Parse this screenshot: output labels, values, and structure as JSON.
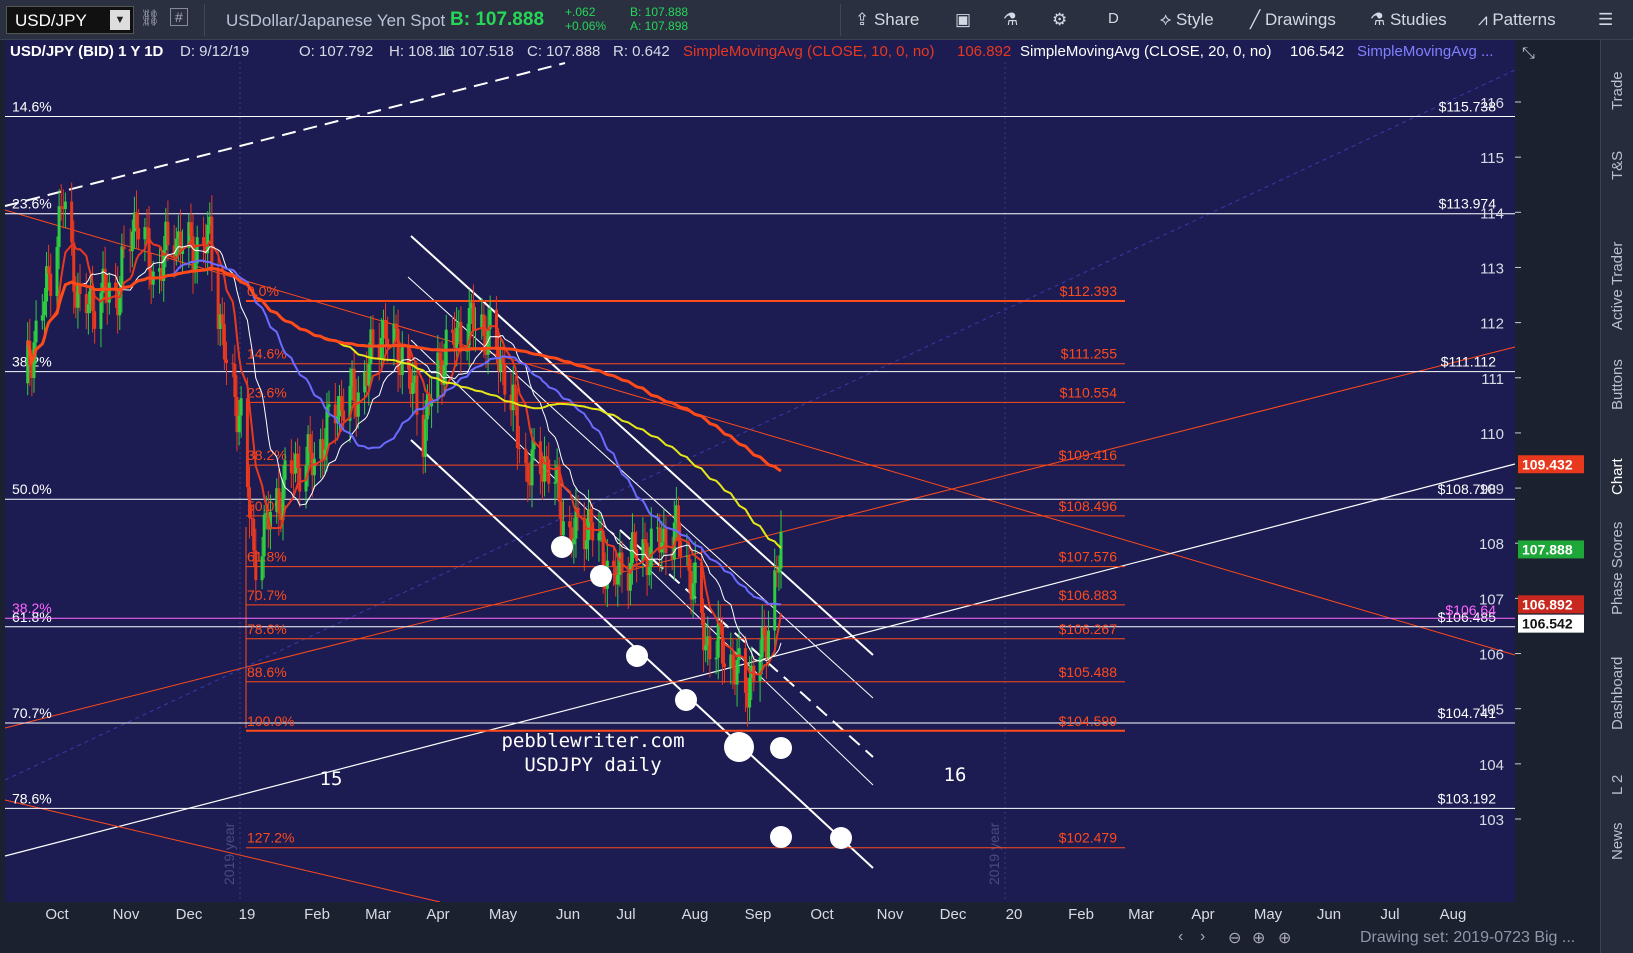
{
  "toolbar": {
    "symbol": "USD/JPY",
    "description": "USDollar/Japanese Yen Spot",
    "bid": "B: 107.888",
    "change_abs": "+.062",
    "change_pct": "+0.06%",
    "bid_small": "B: 107.888",
    "ask_small": "A: 107.898",
    "share_label": "Share",
    "period_label": "D",
    "style_label": "Style",
    "drawings_label": "Drawings",
    "studies_label": "Studies",
    "patterns_label": "Patterns"
  },
  "legend": {
    "title": "USD/JPY (BID) 1 Y 1D",
    "date": "D: 9/12/19",
    "open": "O: 107.792",
    "high": "H: 108.16",
    "low": "L: 107.518",
    "close": "C: 107.888",
    "range": "R: 0.642",
    "sma10": "SimpleMovingAvg (CLOSE, 10, 0, no)",
    "sma10_val": "106.892",
    "sma20": "SimpleMovingAvg (CLOSE, 20, 0, no)",
    "sma20_val": "106.542",
    "sma_more": "SimpleMovingAvg ..."
  },
  "side_tabs": [
    "Trade",
    "T&S",
    "Active Trader",
    "Buttons",
    "Chart",
    "Phase Scores",
    "Dashboard",
    "L 2",
    "News"
  ],
  "bottom": {
    "drawing_set": "Drawing set: 2019-0723 Big ..."
  },
  "colors": {
    "background": "#1c1c52",
    "candle_up": "#2ecc40",
    "candle_down": "#e8391f",
    "sma10": "#e8391f",
    "sma20_white": "#ffffff",
    "sma50_blue": "#6a6aff",
    "sma100_yellow": "#e6e619",
    "sma200_orange": "#ff4a1a",
    "fib_red": "#ff4a1a",
    "fib_white": "#ffffff",
    "pink": "#ff66ff"
  },
  "chart_data": {
    "type": "candlestick",
    "symbol": "USD/JPY",
    "timeframe": "1 Y 1D",
    "ylim": [
      102.3,
      117.0
    ],
    "y_ticks": [
      103,
      104,
      105,
      106,
      107,
      108,
      109,
      110,
      111,
      112,
      113,
      114,
      115,
      116
    ],
    "x_labels": [
      "Oct",
      "Nov",
      "Dec",
      "19",
      "Feb",
      "Mar",
      "Apr",
      "May",
      "Jun",
      "Jul",
      "Aug",
      "Sep",
      "Oct",
      "Nov",
      "Dec",
      "20",
      "Feb",
      "Mar",
      "Apr",
      "May",
      "Jun",
      "Jul",
      "Aug"
    ],
    "year_markers": [
      "2019 year",
      "2019 year"
    ],
    "price_tags": [
      {
        "value": 109.432,
        "label": "109.432",
        "color": "#e8391f"
      },
      {
        "value": 107.888,
        "label": "107.888",
        "color": "#1ea83a"
      },
      {
        "value": 106.892,
        "label": "106.892",
        "color": "#c8281e"
      },
      {
        "value": 106.542,
        "label": "106.542",
        "color": "#ffffff"
      }
    ],
    "close_series": [
      {
        "date": "2018-09-15",
        "close": 110.9
      },
      {
        "date": "2018-09-25",
        "close": 112.4
      },
      {
        "date": "2018-10-04",
        "close": 114.2
      },
      {
        "date": "2018-10-12",
        "close": 112.2
      },
      {
        "date": "2018-10-22",
        "close": 112.5
      },
      {
        "date": "2018-10-30",
        "close": 112.6
      },
      {
        "date": "2018-11-08",
        "close": 114.0
      },
      {
        "date": "2018-11-16",
        "close": 112.8
      },
      {
        "date": "2018-11-26",
        "close": 113.6
      },
      {
        "date": "2018-12-04",
        "close": 113.3
      },
      {
        "date": "2018-12-13",
        "close": 113.5
      },
      {
        "date": "2018-12-21",
        "close": 111.2
      },
      {
        "date": "2018-12-28",
        "close": 110.3
      },
      {
        "date": "2019-01-03",
        "close": 107.7
      },
      {
        "date": "2019-01-10",
        "close": 108.4
      },
      {
        "date": "2019-01-22",
        "close": 109.4
      },
      {
        "date": "2019-02-01",
        "close": 109.5
      },
      {
        "date": "2019-02-12",
        "close": 110.5
      },
      {
        "date": "2019-02-22",
        "close": 110.7
      },
      {
        "date": "2019-03-05",
        "close": 111.9
      },
      {
        "date": "2019-03-15",
        "close": 111.4
      },
      {
        "date": "2019-03-25",
        "close": 110.1
      },
      {
        "date": "2019-04-03",
        "close": 111.4
      },
      {
        "date": "2019-04-15",
        "close": 112.0
      },
      {
        "date": "2019-04-24",
        "close": 111.9
      },
      {
        "date": "2019-05-03",
        "close": 111.1
      },
      {
        "date": "2019-05-13",
        "close": 109.3
      },
      {
        "date": "2019-05-23",
        "close": 109.5
      },
      {
        "date": "2019-06-03",
        "close": 108.1
      },
      {
        "date": "2019-06-12",
        "close": 108.4
      },
      {
        "date": "2019-06-24",
        "close": 107.3
      },
      {
        "date": "2019-07-03",
        "close": 107.8
      },
      {
        "date": "2019-07-12",
        "close": 107.9
      },
      {
        "date": "2019-07-24",
        "close": 108.2
      },
      {
        "date": "2019-08-01",
        "close": 107.3
      },
      {
        "date": "2019-08-07",
        "close": 106.2
      },
      {
        "date": "2019-08-15",
        "close": 106.1
      },
      {
        "date": "2019-08-26",
        "close": 105.4
      },
      {
        "date": "2019-09-03",
        "close": 106.0
      },
      {
        "date": "2019-09-12",
        "close": 107.888
      }
    ],
    "fib_levels_left_white": [
      {
        "label": "14.6%",
        "value": 115.738,
        "price_label": "$115.738"
      },
      {
        "label": "23.6%",
        "value": 113.974,
        "price_label": "$113.974"
      },
      {
        "label": "38.2%",
        "value": 111.112,
        "price_label": "$111.112"
      },
      {
        "label": "50.0%",
        "value": 108.798,
        "price_label": "$108.798"
      },
      {
        "label": "61.8%",
        "value": 106.485,
        "price_label": "$106.485"
      },
      {
        "label": "70.7%",
        "value": 104.741,
        "price_label": "$104.741"
      },
      {
        "label": "78.6%",
        "value": 103.192,
        "price_label": "$103.192"
      }
    ],
    "fib_levels_red": [
      {
        "label": "0.0%",
        "value": 112.393,
        "price_label": "$112.393"
      },
      {
        "label": "14.6%",
        "value": 111.255,
        "price_label": "$111.255"
      },
      {
        "label": "23.6%",
        "value": 110.554,
        "price_label": "$110.554"
      },
      {
        "label": "38.2%",
        "value": 109.416,
        "price_label": "$109.416"
      },
      {
        "label": "50.0%",
        "value": 108.496,
        "price_label": "$108.496"
      },
      {
        "label": "61.8%",
        "value": 107.576,
        "price_label": "$107.576"
      },
      {
        "label": "70.7%",
        "value": 106.883,
        "price_label": "$106.883"
      },
      {
        "label": "78.6%",
        "value": 106.267,
        "price_label": "$106.267"
      },
      {
        "label": "88.6%",
        "value": 105.488,
        "price_label": "$105.488"
      },
      {
        "label": "100.0%",
        "value": 104.599,
        "price_label": "$104.599"
      },
      {
        "label": "127.2%",
        "value": 102.479,
        "price_label": "$102.479"
      }
    ],
    "pink_level": {
      "label": "38.2%",
      "value": 106.64,
      "price_label": "$106.64"
    },
    "annotations": [
      "pebblewriter.com",
      "USDJPY daily",
      "15",
      "16"
    ]
  }
}
